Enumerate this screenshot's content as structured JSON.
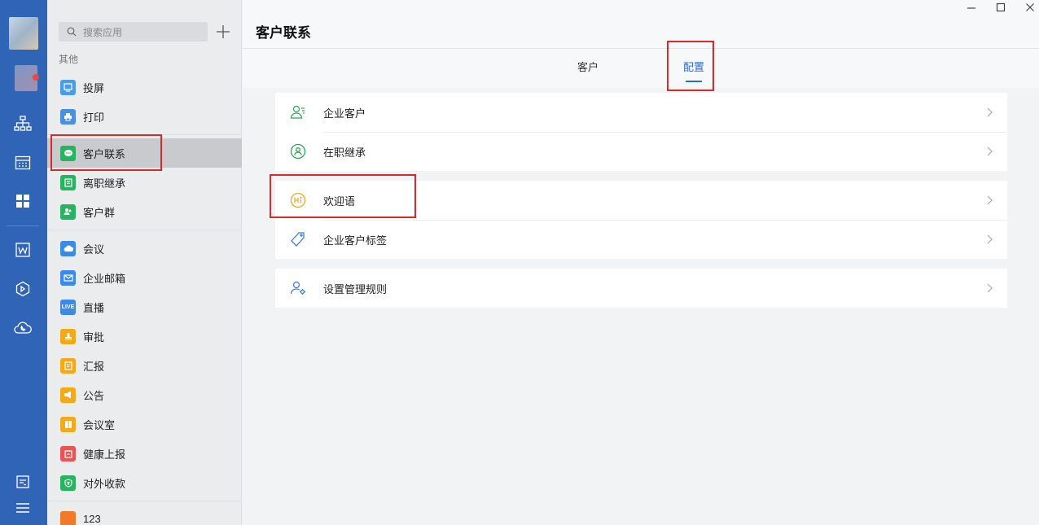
{
  "sidebar": {
    "search_placeholder": "搜索应用",
    "group_label": "其他",
    "items": [
      {
        "label": "投屏",
        "color": "#4a9be8"
      },
      {
        "label": "打印",
        "color": "#4a8fe0"
      },
      {
        "label": "客户联系",
        "color": "#27b35f"
      },
      {
        "label": "离职继承",
        "color": "#27b35f"
      },
      {
        "label": "客户群",
        "color": "#27b35f"
      },
      {
        "label": "会议",
        "color": "#3d8ae6"
      },
      {
        "label": "企业邮箱",
        "color": "#3d8ae6"
      },
      {
        "label": "直播",
        "color": "#3d8ae6",
        "icon_text": "LIVE"
      },
      {
        "label": "审批",
        "color": "#f4a91a"
      },
      {
        "label": "汇报",
        "color": "#f4a91a"
      },
      {
        "label": "公告",
        "color": "#f4a91a"
      },
      {
        "label": "会议室",
        "color": "#f4a91a"
      },
      {
        "label": "健康上报",
        "color": "#ea5455"
      },
      {
        "label": "对外收款",
        "color": "#27b35f"
      },
      {
        "label": "123",
        "color": "#f07a2a"
      }
    ]
  },
  "main": {
    "title": "客户联系",
    "tabs": [
      {
        "label": "客户",
        "active": false
      },
      {
        "label": "配置",
        "active": true
      }
    ],
    "sections": [
      {
        "rows": [
          {
            "label": "企业客户",
            "icon": "user-list-icon"
          },
          {
            "label": "在职继承",
            "icon": "user-transfer-icon"
          }
        ]
      },
      {
        "rows": [
          {
            "label": "欢迎语",
            "icon": "hi-icon"
          },
          {
            "label": "企业客户标签",
            "icon": "tag-icon"
          }
        ]
      },
      {
        "rows": [
          {
            "label": "设置管理规则",
            "icon": "user-settings-icon"
          }
        ]
      }
    ]
  },
  "colors": {
    "accent": "#2f6ad0",
    "rail": "#2f64b6",
    "highlight": "#d82a2a"
  }
}
